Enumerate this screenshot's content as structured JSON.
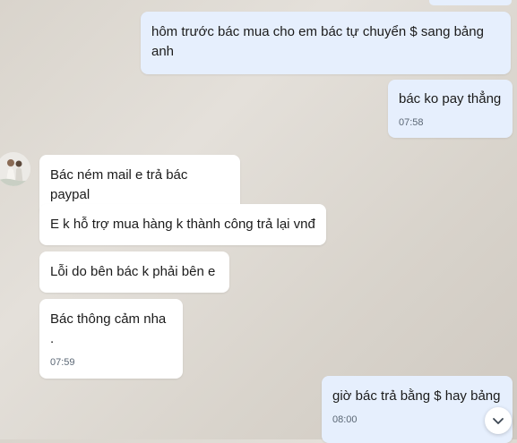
{
  "messages": [
    {
      "id": "m1",
      "direction": "out",
      "text": "hôm trước bác mua cho em bác tự chuyển $ sang bảng anh",
      "time": ""
    },
    {
      "id": "m2",
      "direction": "out",
      "text": "bác ko pay thẳng",
      "time": "07:58"
    },
    {
      "id": "m3",
      "direction": "in",
      "text": "Bác ném mail e trả bác paypal",
      "time": ""
    },
    {
      "id": "m4",
      "direction": "in",
      "text": "E k hỗ trợ mua hàng k thành công trả lại vnđ",
      "time": ""
    },
    {
      "id": "m5",
      "direction": "in",
      "text": "Lỗi do bên bác k phải bên e",
      "time": ""
    },
    {
      "id": "m6",
      "direction": "in",
      "text": "Bác thông cảm nha .",
      "time": "07:59"
    },
    {
      "id": "m7",
      "direction": "out",
      "text": "giờ bác trả bằng $ hay bảng",
      "time": "08:00"
    }
  ],
  "icons": {
    "scroll_down": "chevron-down-icon",
    "avatar": "contact-avatar"
  },
  "colors": {
    "outgoing_bubble": "#e6effd",
    "incoming_bubble": "#ffffff",
    "timestamp": "#5b6775"
  }
}
